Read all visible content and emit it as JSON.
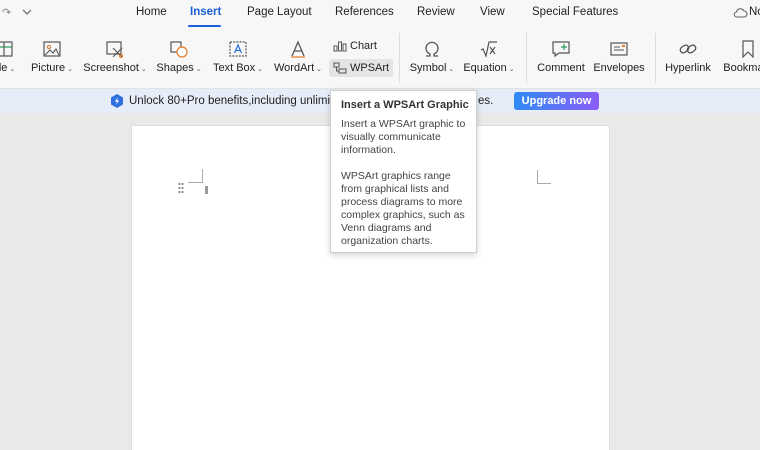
{
  "menu": {
    "tabs": [
      "Home",
      "Insert",
      "Page Layout",
      "References",
      "Review",
      "View",
      "Special Features"
    ],
    "active": "Insert",
    "right_label": "No"
  },
  "ribbon": {
    "table_label": "ble",
    "picture_label": "Picture",
    "screenshot_label": "Screenshot",
    "shapes_label": "Shapes",
    "textbox_label": "Text Box",
    "wordart_label": "WordArt",
    "chart_label": "Chart",
    "wpsart_label": "WPSArt",
    "symbol_label": "Symbol",
    "equation_label": "Equation",
    "comment_label": "Comment",
    "envelopes_label": "Envelopes",
    "hyperlink_label": "Hyperlink",
    "bookmark_label": "Bookmark"
  },
  "promo": {
    "text": "Unlock 80+Pro benefits,including unlimited",
    "text_tail": "es.",
    "button": "Upgrade now"
  },
  "tooltip": {
    "title": "Insert a WPSArt Graphic",
    "p1": "Insert a WPSArt graphic to visually communicate information.",
    "p2": "WPSArt graphics range from graphical lists and process diagrams to more complex graphics, such as Venn diagrams and organization charts."
  },
  "colors": {
    "accent": "#1a5fd8",
    "promo_bg": "#e6edf9"
  }
}
